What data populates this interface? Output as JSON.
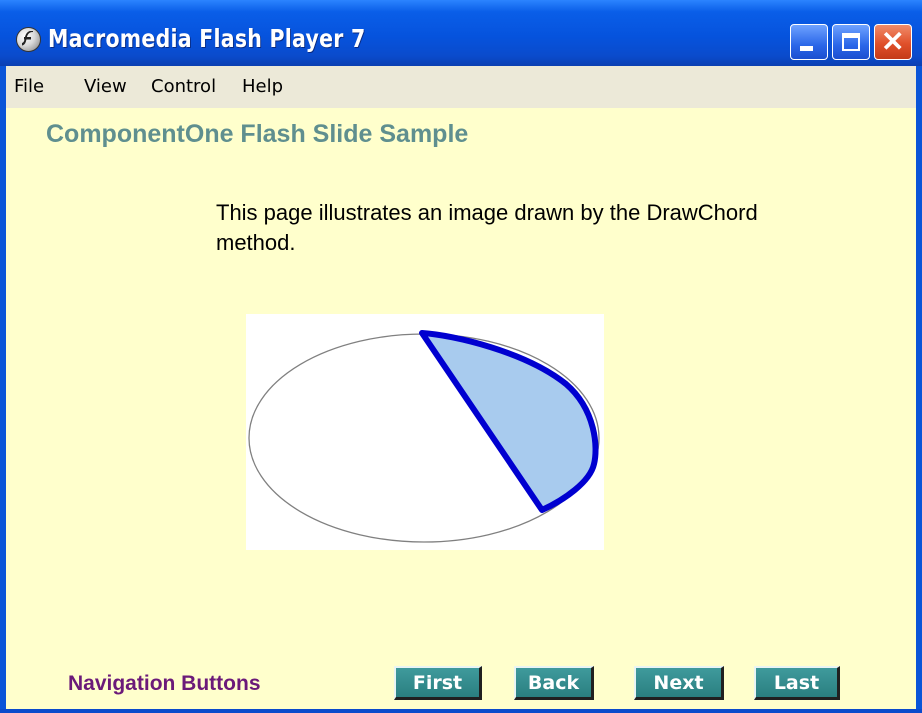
{
  "window": {
    "title": "Macromedia Flash Player 7",
    "controls": {
      "minimize": "minimize",
      "maximize": "maximize",
      "close": "close"
    }
  },
  "menu": {
    "items": [
      "File",
      "View",
      "Control",
      "Help"
    ]
  },
  "slide": {
    "title": "ComponentOne Flash Slide Sample",
    "description": "This page illustrates an image drawn by the DrawChord method."
  },
  "navigation": {
    "label": "Navigation Buttons",
    "buttons": [
      "First",
      "Back",
      "Next",
      "Last"
    ]
  },
  "colors": {
    "title_bar": "#0653dd",
    "content_background": "#ffffcc",
    "slide_title": "#5f8f8f",
    "nav_label": "#6b1a79",
    "nav_button": "#2a7f80",
    "chord_fill": "#a8cbee",
    "chord_stroke": "#0000d0",
    "ellipse_stroke": "#808080"
  },
  "icons": {
    "app": "flash-player-icon"
  }
}
